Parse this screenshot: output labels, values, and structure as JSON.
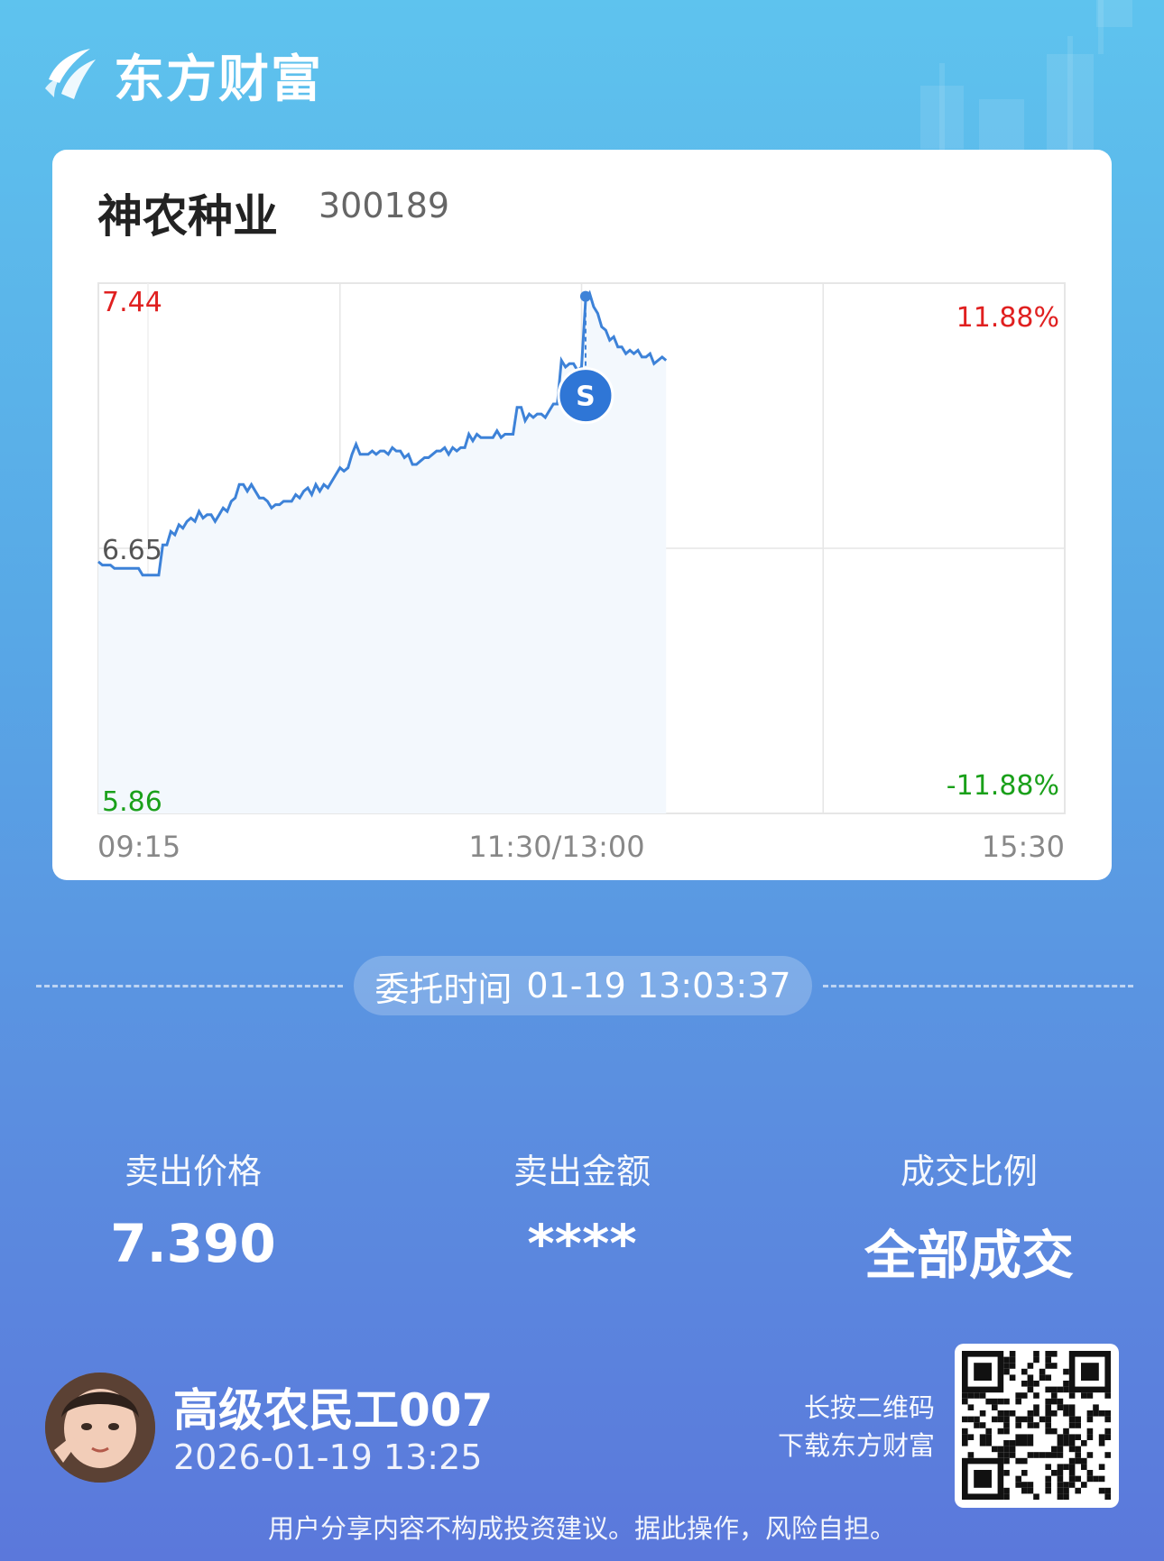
{
  "brand": {
    "name": "东方财富",
    "logo_icon": "eastmoney-logo-icon"
  },
  "stock": {
    "name": "神农种业",
    "code": "300189"
  },
  "chart_data": {
    "type": "line",
    "x_labels": [
      "09:15",
      "11:30/13:00",
      "15:30"
    ],
    "y_left": {
      "top": "7.44",
      "mid": "6.65",
      "bottom": "5.86"
    },
    "y_right": {
      "top": "11.88%",
      "bottom": "-11.88%"
    },
    "ylim": [
      5.86,
      7.44
    ],
    "prev_close": 6.65,
    "colors": {
      "line": "#3d82d8",
      "up": "#e02020",
      "down": "#1aa01a",
      "area": "#f3f8fd"
    },
    "prices": [
      6.61,
      6.6,
      6.6,
      6.6,
      6.59,
      6.59,
      6.59,
      6.59,
      6.59,
      6.59,
      6.59,
      6.57,
      6.57,
      6.57,
      6.57,
      6.57,
      6.66,
      6.66,
      6.7,
      6.69,
      6.72,
      6.71,
      6.73,
      6.74,
      6.73,
      6.76,
      6.74,
      6.75,
      6.75,
      6.73,
      6.75,
      6.77,
      6.76,
      6.79,
      6.8,
      6.84,
      6.84,
      6.82,
      6.84,
      6.82,
      6.8,
      6.8,
      6.79,
      6.77,
      6.78,
      6.78,
      6.79,
      6.79,
      6.79,
      6.81,
      6.8,
      6.82,
      6.83,
      6.81,
      6.84,
      6.82,
      6.84,
      6.83,
      6.85,
      6.87,
      6.89,
      6.88,
      6.89,
      6.93,
      6.96,
      6.93,
      6.93,
      6.93,
      6.94,
      6.93,
      6.94,
      6.94,
      6.93,
      6.95,
      6.94,
      6.94,
      6.92,
      6.93,
      6.9,
      6.9,
      6.91,
      6.92,
      6.92,
      6.93,
      6.94,
      6.94,
      6.95,
      6.93,
      6.95,
      6.94,
      6.95,
      6.95,
      6.99,
      6.97,
      6.99,
      6.98,
      6.98,
      6.98,
      6.98,
      7.0,
      6.98,
      6.99,
      6.99,
      6.99,
      7.07,
      7.07,
      7.03,
      7.05,
      7.04,
      7.05,
      7.05,
      7.04,
      7.06,
      7.08,
      7.08,
      7.21,
      7.19,
      7.2,
      7.2,
      7.18,
      7.19,
      7.39,
      7.41,
      7.37,
      7.35,
      7.31,
      7.3,
      7.27,
      7.28,
      7.25,
      7.25,
      7.23,
      7.24,
      7.23,
      7.24,
      7.22,
      7.22,
      7.23,
      7.2,
      7.21,
      7.22,
      7.21
    ],
    "marker": {
      "label": "S",
      "price": 7.39,
      "time": "13:03"
    }
  },
  "order": {
    "time_label": "委托时间",
    "time_value": "01-19 13:03:37"
  },
  "stats": [
    {
      "label": "卖出价格",
      "value": "7.390"
    },
    {
      "label": "卖出金额",
      "value": "****"
    },
    {
      "label": "成交比例",
      "value": "全部成交"
    }
  ],
  "user": {
    "name": "高级农民工007",
    "datetime": "2026-01-19 13:25"
  },
  "qr": {
    "hint_line1": "长按二维码",
    "hint_line2": "下载东方财富"
  },
  "disclaimer": "用户分享内容不构成投资建议。据此操作，风险自担。"
}
